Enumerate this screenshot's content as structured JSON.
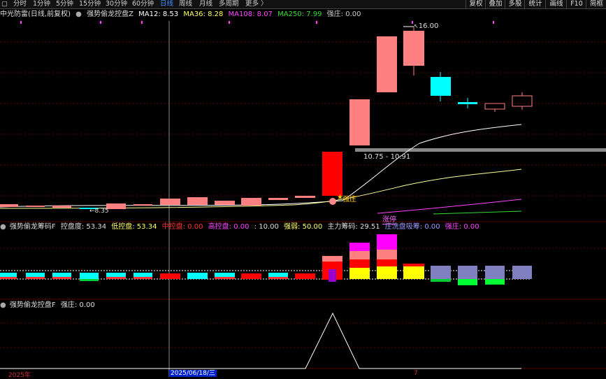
{
  "toolbar": {
    "window_icon": "window-icon",
    "tabs": [
      "分时",
      "1分钟",
      "5分钟",
      "15分钟",
      "30分钟",
      "60分钟",
      "日线",
      "周线",
      "月线",
      "多周期",
      "更多"
    ],
    "active_tab": "日线",
    "right_buttons": [
      "复权",
      "叠加",
      "多股",
      "统计",
      "画线",
      "F10",
      "简框"
    ]
  },
  "main_header": {
    "stock_name": "中光防雷(日线,前复权)",
    "indicator": "强势偷龙控盘Z",
    "ma12": "MA12: 8.53",
    "ma36": "MA36: 8.28",
    "ma108": "MA108: 8.07",
    "ma250": "MA250: 7.99",
    "qiangzhuang": "强庄: 0.00"
  },
  "chart_labels": {
    "high_price": "16.00",
    "range_label": "10.75 - 10.91",
    "low_price": "8.35",
    "zhuang_label": "强庄",
    "zhangting_label": "涨停"
  },
  "sub1_header": {
    "name": "强势偷龙筹码F",
    "kongpan": "控盘度: 53.34",
    "dikongpan": "低控盘: 53.34",
    "zhongkongpan": "中控盘: 0.00",
    "gaokongpan": "高控盘: 0.00",
    "val10": ": 10.00",
    "qiangruo": "强弱: 50.00",
    "zhuli": "主力筹码: 29.51",
    "xipan": "庄洗盘吸筹: 0.00",
    "qiangzhuang": "强庄: 0.00"
  },
  "sub2_header": {
    "name": "强势偷龙控盘F",
    "qiangzhuang": "强庄: 0.00"
  },
  "date_axis": {
    "year": "2025年",
    "date": "2025/06/18/三",
    "marker": "7"
  },
  "colors": {
    "bull": "#ff8080",
    "bear": "#00ffff",
    "limit_up": "#ff0000",
    "ma12": "#ffffff",
    "ma36": "#ffff99",
    "ma108": "#ff00ff",
    "ma250": "#00cc00",
    "bg": "#000000",
    "grid": "#5a0000"
  }
}
